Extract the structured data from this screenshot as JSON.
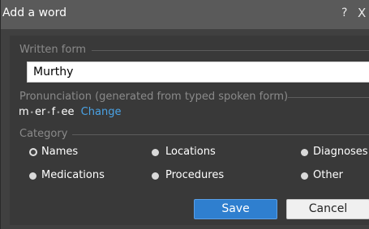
{
  "dialog": {
    "title": "Add a word",
    "help_label": "?",
    "close_label": "X"
  },
  "written_form": {
    "legend": "Written form",
    "value": "Murthy"
  },
  "pronunciation": {
    "legend": "Pronunciation (generated from typed spoken form)",
    "syllables": [
      "m",
      "er",
      "f",
      "ee"
    ],
    "change_label": "Change"
  },
  "category": {
    "legend": "Category",
    "options": [
      {
        "label": "Names",
        "selected": true
      },
      {
        "label": "Locations",
        "selected": false
      },
      {
        "label": "Diagnoses",
        "selected": false
      },
      {
        "label": "Medications",
        "selected": false
      },
      {
        "label": "Procedures",
        "selected": false
      },
      {
        "label": "Other",
        "selected": false
      }
    ]
  },
  "buttons": {
    "save_label": "Save",
    "cancel_label": "Cancel"
  },
  "colors": {
    "accent": "#2f7fcf",
    "link": "#4aa3e6",
    "background": "#404040"
  }
}
